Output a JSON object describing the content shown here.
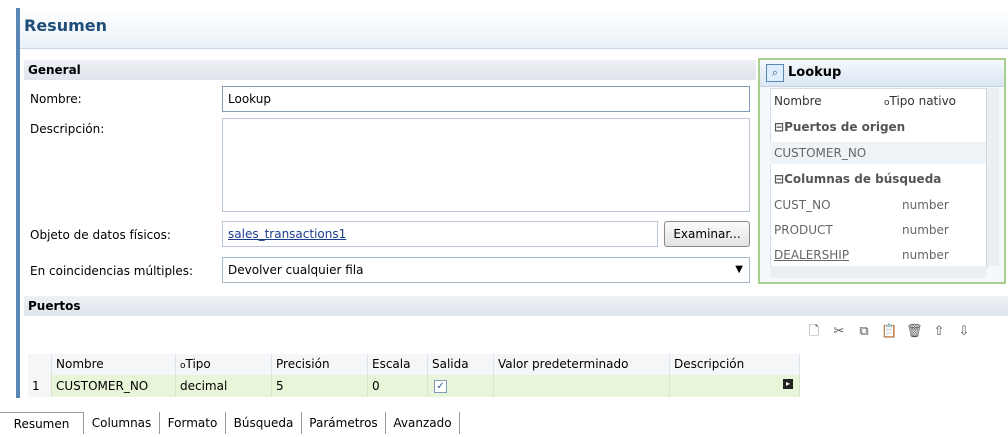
{
  "header": {
    "title": "Resumen"
  },
  "general": {
    "section_title": "General",
    "name_label": "Nombre:",
    "name_value": "Lookup",
    "description_label": "Descripción:",
    "description_value": "",
    "physical_object_label": "Objeto de datos físicos:",
    "physical_object_value": "sales_transactions1",
    "browse_button": "Examinar...",
    "multiple_matches_label": "En coincidencias múltiples:",
    "multiple_matches_value": "Devolver cualquier fila"
  },
  "lookup_panel": {
    "title": "Lookup",
    "col_name": "Nombre",
    "col_type": "Tipo nativo",
    "source_group": "Puertos de origen",
    "source_ports": [
      {
        "name": "CUSTOMER_NO",
        "type": ""
      }
    ],
    "lookup_group": "Columnas de búsqueda",
    "lookup_columns": [
      {
        "name": "CUST_NO",
        "type": "number"
      },
      {
        "name": "PRODUCT",
        "type": "number"
      },
      {
        "name": "DEALERSHIP",
        "type": "number"
      }
    ]
  },
  "ports": {
    "section_title": "Puertos",
    "toolbar_icons": [
      "new-icon",
      "cut-icon",
      "copy-icon",
      "paste-icon",
      "delete-icon",
      "move-up-icon",
      "move-down-icon"
    ],
    "columns": [
      "Nombre",
      "Tipo",
      "Precisión",
      "Escala",
      "Salida",
      "Valor predeterminado",
      "Descripción"
    ],
    "rows": [
      {
        "index": "1",
        "name": "CUSTOMER_NO",
        "type": "decimal",
        "precision": "5",
        "scale": "0",
        "output": true,
        "default": "",
        "description": ""
      }
    ]
  },
  "tabs": [
    "Resumen",
    "Columnas",
    "Formato",
    "Búsqueda",
    "Parámetros",
    "Avanzado"
  ],
  "colors": {
    "accent": "#1f4e79",
    "row_highlight": "#e9f5d8",
    "panel_border": "#a8d08d"
  }
}
